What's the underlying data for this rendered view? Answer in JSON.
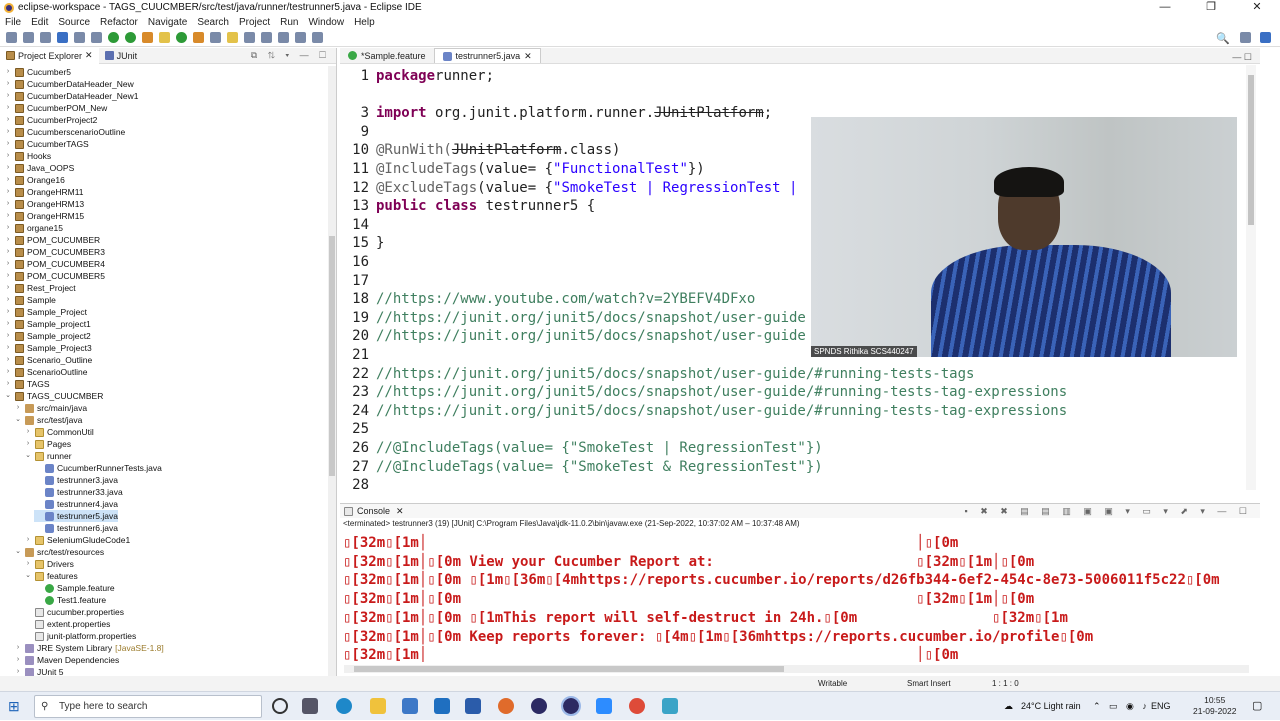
{
  "window": {
    "title": "eclipse-workspace - TAGS_CUUCMBER/src/test/java/runner/testrunner5.java - Eclipse IDE",
    "minimize": "—",
    "maximize": "❐",
    "close": "✕"
  },
  "menu": [
    "File",
    "Edit",
    "Source",
    "Refactor",
    "Navigate",
    "Search",
    "Project",
    "Run",
    "Window",
    "Help"
  ],
  "left_tabs": [
    "Project Explorer",
    "JUnit"
  ],
  "tree": [
    {
      "label": "Cucumber5",
      "depth": 0,
      "icon": "project-icon"
    },
    {
      "label": "CucumberDataHeader_New",
      "depth": 0,
      "icon": "project-icon"
    },
    {
      "label": "CucumberDataHeader_New1",
      "depth": 0,
      "icon": "project-icon"
    },
    {
      "label": "CucumberPOM_New",
      "depth": 0,
      "icon": "project-icon"
    },
    {
      "label": "CucumberProject2",
      "depth": 0,
      "icon": "project-icon"
    },
    {
      "label": "CucumberscenarioOutline",
      "depth": 0,
      "icon": "project-icon"
    },
    {
      "label": "CucumberTAGS",
      "depth": 0,
      "icon": "project-icon"
    },
    {
      "label": "Hooks",
      "depth": 0,
      "icon": "project-icon"
    },
    {
      "label": "Java_OOPS",
      "depth": 0,
      "icon": "project-icon"
    },
    {
      "label": "Orange16",
      "depth": 0,
      "icon": "project-icon"
    },
    {
      "label": "OrangeHRM11",
      "depth": 0,
      "icon": "project-icon"
    },
    {
      "label": "OrangeHRM13",
      "depth": 0,
      "icon": "project-icon"
    },
    {
      "label": "OrangeHRM15",
      "depth": 0,
      "icon": "project-icon"
    },
    {
      "label": "organe15",
      "depth": 0,
      "icon": "project-icon"
    },
    {
      "label": "POM_CUCUMBER",
      "depth": 0,
      "icon": "project-icon"
    },
    {
      "label": "POM_CUCUMBER3",
      "depth": 0,
      "icon": "project-icon"
    },
    {
      "label": "POM_CUCUMBER4",
      "depth": 0,
      "icon": "project-icon"
    },
    {
      "label": "POM_CUCUMBER5",
      "depth": 0,
      "icon": "project-icon"
    },
    {
      "label": "Rest_Project",
      "depth": 0,
      "icon": "project-icon"
    },
    {
      "label": "Sample",
      "depth": 0,
      "icon": "project-icon"
    },
    {
      "label": "Sample_Project",
      "depth": 0,
      "icon": "project-icon"
    },
    {
      "label": "Sample_project1",
      "depth": 0,
      "icon": "project-icon"
    },
    {
      "label": "Sample_project2",
      "depth": 0,
      "icon": "project-icon"
    },
    {
      "label": "Sample_Project3",
      "depth": 0,
      "icon": "project-icon"
    },
    {
      "label": "Scenario_Outline",
      "depth": 0,
      "icon": "project-icon"
    },
    {
      "label": "ScenarioOutline",
      "depth": 0,
      "icon": "project-icon"
    },
    {
      "label": "TAGS",
      "depth": 0,
      "icon": "project-icon"
    },
    {
      "label": "TAGS_CUUCMBER",
      "depth": 0,
      "icon": "project-icon",
      "open": true
    },
    {
      "label": "src/main/java",
      "depth": 1,
      "icon": "package-icon"
    },
    {
      "label": "src/test/java",
      "depth": 1,
      "icon": "package-icon",
      "open": true
    },
    {
      "label": "CommonUtil",
      "depth": 2,
      "icon": "folder-icon"
    },
    {
      "label": "Pages",
      "depth": 2,
      "icon": "folder-icon"
    },
    {
      "label": "runner",
      "depth": 2,
      "icon": "folder-icon",
      "open": true
    },
    {
      "label": "CucumberRunnerTests.java",
      "depth": 3,
      "icon": "java-icon"
    },
    {
      "label": "testrunner3.java",
      "depth": 3,
      "icon": "java-icon"
    },
    {
      "label": "testrunner33.java",
      "depth": 3,
      "icon": "java-icon"
    },
    {
      "label": "testrunner4.java",
      "depth": 3,
      "icon": "java-icon"
    },
    {
      "label": "testrunner5.java",
      "depth": 3,
      "icon": "java-icon",
      "selected": true
    },
    {
      "label": "testrunner6.java",
      "depth": 3,
      "icon": "java-icon"
    },
    {
      "label": "SeleniumGludeCode1",
      "depth": 2,
      "icon": "folder-icon"
    },
    {
      "label": "src/test/resources",
      "depth": 1,
      "icon": "package-icon",
      "open": true
    },
    {
      "label": "Drivers",
      "depth": 2,
      "icon": "folder-icon"
    },
    {
      "label": "features",
      "depth": 2,
      "icon": "folder-icon",
      "open": true
    },
    {
      "label": "Sample.feature",
      "depth": 3,
      "icon": "feature-icon"
    },
    {
      "label": "Test1.feature",
      "depth": 3,
      "icon": "feature-icon"
    },
    {
      "label": "cucumber.properties",
      "depth": 2,
      "icon": "file-icon"
    },
    {
      "label": "extent.properties",
      "depth": 2,
      "icon": "file-icon"
    },
    {
      "label": "junit-platform.properties",
      "depth": 2,
      "icon": "file-icon"
    },
    {
      "label": "JRE System Library",
      "suffix": "[JavaSE-1.8]",
      "depth": 1,
      "icon": "library-icon"
    },
    {
      "label": "Maven Dependencies",
      "depth": 1,
      "icon": "library-icon"
    },
    {
      "label": "JUnit 5",
      "depth": 1,
      "icon": "library-icon"
    }
  ],
  "editor_tabs": [
    {
      "label": "*Sample.feature",
      "active": false
    },
    {
      "label": "testrunner5.java",
      "active": true
    }
  ],
  "code_lines": [
    {
      "n": "1",
      "parts": [
        [
          "kw",
          "package"
        ],
        [
          "",
          "runner;"
        ]
      ]
    },
    {
      "n": "",
      "parts": []
    },
    {
      "n": "3",
      "parts": [
        [
          "kw",
          "import"
        ],
        [
          "",
          " org.junit.platform.runner."
        ],
        [
          "strike",
          "JUnitPlatform"
        ],
        [
          "",
          ";"
        ]
      ]
    },
    {
      "n": "9",
      "parts": []
    },
    {
      "n": "10",
      "parts": [
        [
          "an",
          "@RunWith("
        ],
        [
          "strike",
          "JUnitPlatform"
        ],
        [
          "",
          ".class)"
        ]
      ]
    },
    {
      "n": "11",
      "parts": [
        [
          "an",
          "@IncludeTags"
        ],
        [
          "",
          "(value= {"
        ],
        [
          "str",
          "\"FunctionalTest\""
        ],
        [
          "",
          "})"
        ]
      ]
    },
    {
      "n": "12",
      "parts": [
        [
          "an",
          "@ExcludeTags"
        ],
        [
          "",
          "(value= {"
        ],
        [
          "str",
          "\"SmokeTest | RegressionTest |"
        ]
      ]
    },
    {
      "n": "13",
      "parts": [
        [
          "kw",
          "public class"
        ],
        [
          "",
          " testrunner5 {"
        ]
      ]
    },
    {
      "n": "14",
      "parts": []
    },
    {
      "n": "15",
      "parts": [
        [
          "",
          "}"
        ]
      ]
    },
    {
      "n": "16",
      "parts": []
    },
    {
      "n": "17",
      "parts": []
    },
    {
      "n": "18",
      "parts": [
        [
          "cm",
          "//https://www.youtube.com/watch?v=2YBEFV4DFxo"
        ]
      ]
    },
    {
      "n": "19",
      "parts": [
        [
          "cm",
          "//https://junit.org/junit5/docs/snapshot/user-guide"
        ]
      ]
    },
    {
      "n": "20",
      "parts": [
        [
          "cm",
          "//https://junit.org/junit5/docs/snapshot/user-guide"
        ]
      ]
    },
    {
      "n": "21",
      "parts": []
    },
    {
      "n": "22",
      "parts": [
        [
          "cm",
          "//https://junit.org/junit5/docs/snapshot/user-guide/#running-tests-tags"
        ]
      ]
    },
    {
      "n": "23",
      "parts": [
        [
          "cm",
          "//https://junit.org/junit5/docs/snapshot/user-guide/#running-tests-tag-expressions"
        ]
      ]
    },
    {
      "n": "24",
      "parts": [
        [
          "cm",
          "//https://junit.org/junit5/docs/snapshot/user-guide/#running-tests-tag-expressions"
        ]
      ]
    },
    {
      "n": "25",
      "parts": []
    },
    {
      "n": "26",
      "parts": [
        [
          "cm",
          "//@IncludeTags(value= {\"SmokeTest | RegressionTest\"})"
        ]
      ]
    },
    {
      "n": "27",
      "parts": [
        [
          "cm",
          "//@IncludeTags(value= {\"SmokeTest & RegressionTest\"})"
        ]
      ]
    },
    {
      "n": "28",
      "parts": []
    }
  ],
  "video": {
    "caption": "SPNDS Rithika SCS440247"
  },
  "console": {
    "tab": "Console",
    "info": "<terminated> testrunner3 (19) [JUnit] C:\\Program Files\\Java\\jdk-11.0.2\\bin\\javaw.exe  (21-Sep-2022, 10:37:02 AM – 10:37:48 AM)",
    "lines": [
      "▯[32m▯[1m│                                                          │▯[0m",
      "▯[32m▯[1m│▯[0m View your Cucumber Report at:                        ▯[32m▯[1m│▯[0m",
      "▯[32m▯[1m│▯[0m ▯[1m▯[36m▯[4mhttps://reports.cucumber.io/reports/d26fb344-6ef2-454c-8e73-5006011f5c22▯[0m",
      "▯[32m▯[1m│▯[0m                                                      ▯[32m▯[1m│▯[0m",
      "▯[32m▯[1m│▯[0m ▯[1mThis report will self-destruct in 24h.▯[0m                ▯[32m▯[1m",
      "▯[32m▯[1m│▯[0m Keep reports forever: ▯[4m▯[1m▯[36mhttps://reports.cucumber.io/profile▯[0m",
      "▯[32m▯[1m│                                                          │▯[0m"
    ]
  },
  "status": {
    "writable": "Writable",
    "insert": "Smart Insert",
    "position": "1 : 1 : 0"
  },
  "taskbar": {
    "search_placeholder": "Type here to search",
    "weather": "24°C  Light rain",
    "lang": "ENG",
    "time": "10:55",
    "date": "21-09-2022"
  },
  "colors": {
    "keyword": "#7f0055",
    "string": "#2a00ff",
    "comment": "#3f7f5f",
    "console_red": "#c81a1a"
  }
}
